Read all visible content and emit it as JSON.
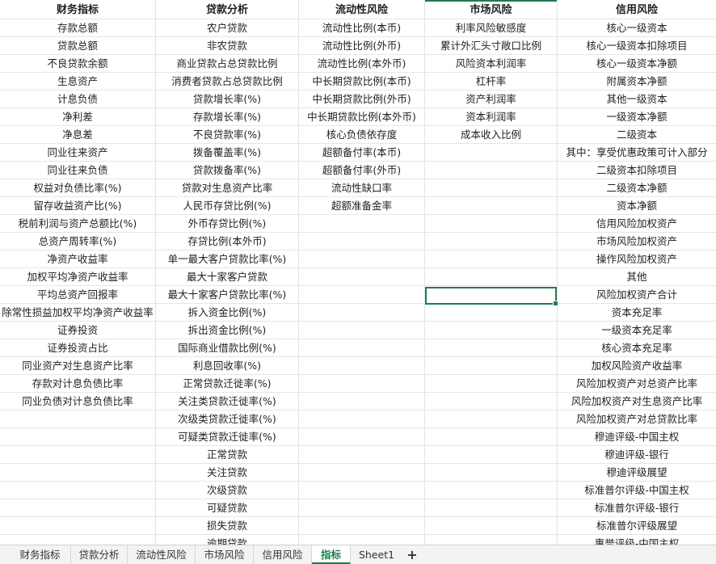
{
  "columns": [
    {
      "header": "财务指标",
      "cells": [
        "存款总额",
        "贷款总额",
        "不良贷款余额",
        "生息资产",
        "计息负债",
        "净利差",
        "净息差",
        "同业往来资产",
        "同业往来负债",
        "权益对负债比率(%)",
        "留存收益资产比(%)",
        "税前利润与资产总额比(%)",
        "总资产周转率(%)",
        "净资产收益率",
        "加权平均净资产收益率",
        "平均总资产回报率",
        "除常性损益加权平均净资产收益率",
        "证券投资",
        "证券投资占比",
        "同业资产对生息资产比率",
        "存款对计息负债比率",
        "同业负债对计息负债比率"
      ]
    },
    {
      "header": "贷款分析",
      "cells": [
        "农户贷款",
        "非农贷款",
        "商业贷款占总贷款比例",
        "消费者贷款占总贷款比例",
        "贷款增长率(%)",
        "存款增长率(%)",
        "不良贷款率(%)",
        "拨备覆盖率(%)",
        "贷款拨备率(%)",
        "贷款对生息资产比率",
        "人民币存贷比例(%)",
        "外币存贷比例(%)",
        "存贷比例(本外币)",
        "单一最大客户贷款比率(%)",
        "最大十家客户贷款",
        "最大十家客户贷款比率(%)",
        "拆入资金比例(%)",
        "拆出资金比例(%)",
        "国际商业借款比例(%)",
        "利息回收率(%)",
        "正常贷款迁徙率(%)",
        "关注类贷款迁徙率(%)",
        "次级类贷款迁徙率(%)",
        "可疑类贷款迁徙率(%)",
        "正常贷款",
        "关注贷款",
        "次级贷款",
        "可疑贷款",
        "损失贷款",
        "逾期贷款"
      ]
    },
    {
      "header": "流动性风险",
      "cells": [
        "流动性比例(本币)",
        "流动性比例(外币)",
        "流动性比例(本外币)",
        "中长期贷款比例(本币)",
        "中长期贷款比例(外币)",
        "中长期贷款比例(本外币)",
        "核心负债依存度",
        "超额备付率(本币)",
        "超额备付率(外币)",
        "流动性缺口率",
        "超额准备金率"
      ]
    },
    {
      "header": "市场风险",
      "cells": [
        "利率风险敏感度",
        "累计外汇头寸敞口比例",
        "风险资本利润率",
        "杠杆率",
        "资产利润率",
        "资本利润率",
        "成本收入比例"
      ]
    },
    {
      "header": "信用风险",
      "cells": [
        "核心一级资本",
        "核心一级资本扣除项目",
        "核心一级资本净额",
        "附属资本净额",
        "其他一级资本",
        "一级资本净额",
        "二级资本",
        "其中：享受优惠政策可计入部分",
        "二级资本扣除项目",
        "二级资本净额",
        "资本净额",
        "信用风险加权资产",
        "市场风险加权资产",
        "操作风险加权资产",
        "其他",
        "风险加权资产合计",
        "资本充足率",
        "一级资本充足率",
        "核心资本充足率",
        "加权风险资产收益率",
        "风险加权资产对总资产比率",
        "风险加权资产对生息资产比率",
        "风险加权资产对总贷款比率",
        "穆迪评级-中国主权",
        "穆迪评级-银行",
        "穆迪评级展望",
        "标准普尔评级-中国主权",
        "标准普尔评级-银行",
        "标准普尔评级展望",
        "惠誉评级-中国主权"
      ]
    }
  ],
  "tabs": [
    "财务指标",
    "贷款分析",
    "流动性风险",
    "市场风险",
    "信用风险",
    "指标",
    "Sheet1"
  ],
  "active_tab": "指标",
  "add_tab_label": "+",
  "colors": {
    "accent": "#1e7d4f",
    "grid": "#e6e6e6"
  }
}
